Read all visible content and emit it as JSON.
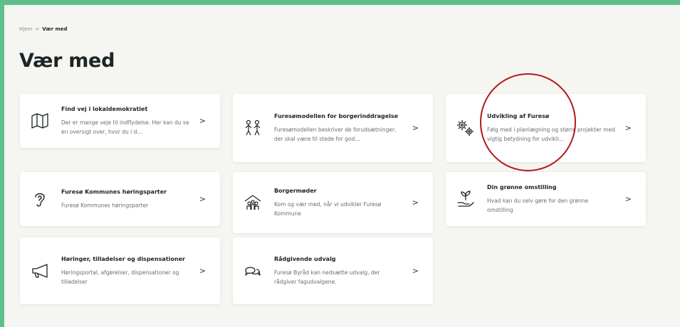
{
  "breadcrumb": {
    "home": "Hjem",
    "separator": ">",
    "current": "Vær med"
  },
  "page_title": "Vær med",
  "cards": [
    {
      "title": "Find vej i lokaldemokratiet",
      "description": "Der er mange veje til indflydelse. Her kan du se en oversigt over, hvor du i d…",
      "icon": "map-icon"
    },
    {
      "title": "Furesømodellen for borgerinddragelse",
      "description": "Furesømodellen beskriver de forudsætninger, der skal være til stede for god…",
      "icon": "people-icon"
    },
    {
      "title": "Udvikling af Furesø",
      "description": "Følg med i planlægning og større projekter med vigtig betydning for udvikli…",
      "icon": "gears-icon"
    },
    {
      "title": "Furesø Kommunes høringsparter",
      "description": "Furesø Kommunes høringsparter",
      "icon": "ear-icon"
    },
    {
      "title": "Borgermøder",
      "description": "Kom og vær med, når vi udvikler Furesø Kommune",
      "icon": "meeting-house-icon"
    },
    {
      "title": "Din grønne omstilling",
      "description": "Hvad kan du selv gøre for den grønne omstilling",
      "icon": "sprout-hand-icon"
    },
    {
      "title": "Høringer, tilladelser og dispensationer",
      "description": "Høringsportal, afgørelser, dispensationer og tilladelser",
      "icon": "megaphone-icon"
    },
    {
      "title": "Rådgivende udvalg",
      "description": "Furesø Byråd kan nedsætte udvalg, der rådgiver fagudvalgene.",
      "icon": "chat-bubbles-icon"
    }
  ],
  "chevron": ">",
  "colors": {
    "background_border": "#5fbf8a",
    "page": "#f5f5f1",
    "card": "#ffffff",
    "highlight_circle": "#b01818"
  }
}
